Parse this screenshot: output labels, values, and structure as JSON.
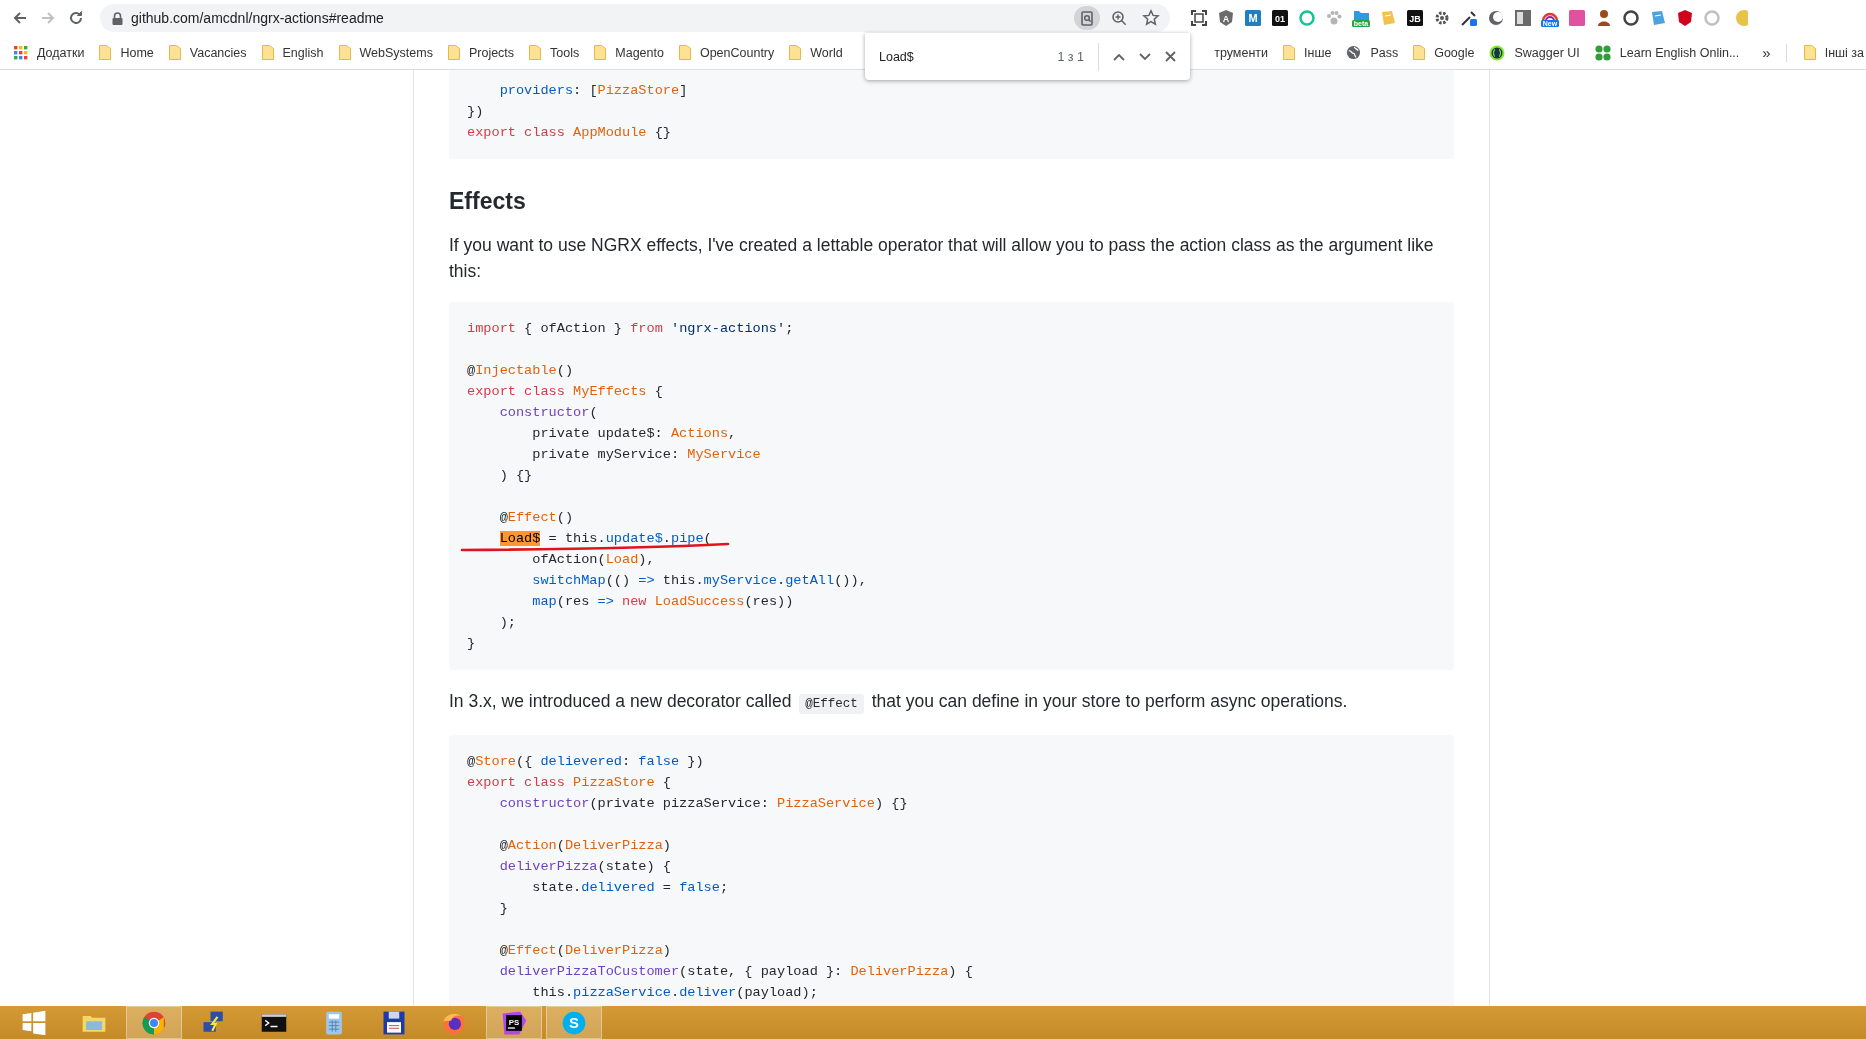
{
  "toolbar": {
    "nav": [
      {
        "kind": "back",
        "disabled": false
      },
      {
        "kind": "forward",
        "disabled": true
      },
      {
        "kind": "reload",
        "disabled": false
      }
    ],
    "url": "github.com/amcdnl/ngrx-actions#readme",
    "url_actions": [
      {
        "kind": "find",
        "active": true
      },
      {
        "kind": "zoom",
        "active": false
      },
      {
        "kind": "star",
        "active": false
      }
    ],
    "extensions": [
      {
        "kind": "crop",
        "color": "#444444"
      },
      {
        "kind": "shield",
        "color": "#6b6b6b",
        "label": "A"
      },
      {
        "kind": "tile",
        "color": "#1f7fc4",
        "label": "M"
      },
      {
        "kind": "tile",
        "color": "#111111",
        "label": "01"
      },
      {
        "kind": "ring",
        "color": "#15c39a"
      },
      {
        "kind": "paw",
        "color": "#b5b5b5"
      },
      {
        "kind": "folder",
        "color": "#2e9ae0",
        "label": "beta"
      },
      {
        "kind": "note",
        "color": "#f2c14e"
      },
      {
        "kind": "tile",
        "color": "#111111",
        "label": "JB"
      },
      {
        "kind": "gear",
        "color": "#555555"
      },
      {
        "kind": "dropper",
        "color": "#1a73e8"
      },
      {
        "kind": "moon",
        "color": "#5f6368"
      },
      {
        "kind": "panel",
        "color": "#6a6a6a"
      },
      {
        "kind": "rainbow",
        "color": "#1a73e8",
        "label": "New"
      },
      {
        "kind": "tile",
        "color": "#e052a0"
      },
      {
        "kind": "blob",
        "color": "#9b4a1c"
      },
      {
        "kind": "ring",
        "color": "#444444"
      },
      {
        "kind": "note",
        "color": "#4aa3df"
      },
      {
        "kind": "shield",
        "color": "#d0021b"
      },
      {
        "kind": "ring",
        "color": "#c0c0c0"
      },
      {
        "kind": "avatar",
        "color": "#e8c34a"
      }
    ]
  },
  "bookmarks": [
    {
      "kind": "apps",
      "label": "Додатки"
    },
    {
      "kind": "folder",
      "label": "Home"
    },
    {
      "kind": "folder",
      "label": "Vacancies"
    },
    {
      "kind": "folder",
      "label": "English"
    },
    {
      "kind": "folder",
      "label": "WebSystems"
    },
    {
      "kind": "folder",
      "label": "Projects"
    },
    {
      "kind": "folder",
      "label": "Tools"
    },
    {
      "kind": "folder",
      "label": "Magento"
    },
    {
      "kind": "folder",
      "label": "OpenCountry"
    },
    {
      "kind": "folder",
      "label": "World"
    }
  ],
  "bookmarks_right": [
    {
      "kind": "cut",
      "label": "трументи"
    },
    {
      "kind": "folder",
      "label": "Інше"
    },
    {
      "kind": "globe",
      "label": "Pass"
    },
    {
      "kind": "folder",
      "label": "Google"
    },
    {
      "kind": "swagger",
      "label": "Swagger UI"
    },
    {
      "kind": "clover",
      "label": "Learn English Onlin..."
    }
  ],
  "bookmarks_more": "»",
  "other_bookmarks": "Інші за",
  "find_bar": {
    "query": "Load$",
    "count": "1 з 1"
  },
  "readme": [
    {
      "kind": "code",
      "cut_top": true,
      "lines": [
        {
          "kind": "code",
          "tokens": [
            {
              "text": "    providers",
              "kind": "constant"
            },
            {
              "text": ": ["
            },
            {
              "text": "PizzaStore",
              "kind": "type"
            },
            {
              "text": "]"
            }
          ]
        },
        {
          "kind": "code",
          "tokens": [
            {
              "text": "})"
            }
          ]
        },
        {
          "kind": "code",
          "tokens": [
            {
              "text": "export class",
              "kind": "keyword"
            },
            {
              "text": " AppModule",
              "kind": "type"
            },
            {
              "text": " {}"
            }
          ]
        }
      ]
    },
    {
      "kind": "heading",
      "text": "Effects"
    },
    {
      "kind": "paragraph",
      "text": "If you want to use NGRX effects, I've created a lettable operator that will allow you to pass the action class as the argument like this:"
    },
    {
      "kind": "code",
      "cut_top": false,
      "lines": [
        {
          "kind": "code",
          "tokens": [
            {
              "text": "import",
              "kind": "keyword"
            },
            {
              "text": " { ofAction } "
            },
            {
              "text": "from",
              "kind": "keyword"
            },
            {
              "text": " 'ngrx-actions'",
              "kind": "string"
            },
            {
              "text": ";"
            }
          ]
        },
        {
          "kind": "blank"
        },
        {
          "kind": "code",
          "tokens": [
            {
              "text": "@"
            },
            {
              "text": "Injectable",
              "kind": "type"
            },
            {
              "text": "()"
            }
          ]
        },
        {
          "kind": "code",
          "tokens": [
            {
              "text": "export class",
              "kind": "keyword"
            },
            {
              "text": " MyEffects",
              "kind": "type"
            },
            {
              "text": " {"
            }
          ]
        },
        {
          "kind": "code",
          "tokens": [
            {
              "text": "    constructor",
              "kind": "function"
            },
            {
              "text": "("
            }
          ]
        },
        {
          "kind": "code",
          "tokens": [
            {
              "text": "        private update$: "
            },
            {
              "text": "Actions",
              "kind": "type"
            },
            {
              "text": ","
            }
          ]
        },
        {
          "kind": "code",
          "tokens": [
            {
              "text": "        private myService: "
            },
            {
              "text": "MyService",
              "kind": "type"
            }
          ]
        },
        {
          "kind": "code",
          "tokens": [
            {
              "text": "    ) {}"
            }
          ]
        },
        {
          "kind": "blank"
        },
        {
          "kind": "code",
          "tokens": [
            {
              "text": "    @"
            },
            {
              "text": "Effect",
              "kind": "type"
            },
            {
              "text": "()"
            }
          ]
        },
        {
          "kind": "code",
          "indented": true,
          "tokens": [
            {
              "text": "Load$",
              "kind": "match"
            },
            {
              "text": " = this."
            },
            {
              "text": "update$",
              "kind": "constant"
            },
            {
              "text": "."
            },
            {
              "text": "pipe",
              "kind": "constant"
            },
            {
              "text": "("
            }
          ]
        },
        {
          "kind": "code",
          "tokens": [
            {
              "text": "        ofAction("
            },
            {
              "text": "Load",
              "kind": "type"
            },
            {
              "text": "),"
            }
          ]
        },
        {
          "kind": "code",
          "tokens": [
            {
              "text": "        switchMap",
              "kind": "constant"
            },
            {
              "text": "(() "
            },
            {
              "text": "=>",
              "kind": "constant"
            },
            {
              "text": " this."
            },
            {
              "text": "myService",
              "kind": "constant"
            },
            {
              "text": "."
            },
            {
              "text": "getAll",
              "kind": "constant"
            },
            {
              "text": "()),"
            }
          ]
        },
        {
          "kind": "code",
          "tokens": [
            {
              "text": "        map",
              "kind": "constant"
            },
            {
              "text": "(res "
            },
            {
              "text": "=>",
              "kind": "constant"
            },
            {
              "text": " new",
              "kind": "keyword"
            },
            {
              "text": " LoadSuccess",
              "kind": "type"
            },
            {
              "text": "(res))"
            }
          ]
        },
        {
          "kind": "code",
          "tokens": [
            {
              "text": "    );"
            }
          ]
        },
        {
          "kind": "code",
          "tokens": [
            {
              "text": "}"
            }
          ]
        }
      ]
    },
    {
      "kind": "paragraph_code",
      "before": "In 3.x, we introduced a new decorator called",
      "code": "@Effect",
      "after": "that you can define in your store to perform async operations."
    },
    {
      "kind": "code",
      "cut_top": false,
      "lines": [
        {
          "kind": "code",
          "tokens": [
            {
              "text": "@"
            },
            {
              "text": "Store",
              "kind": "type"
            },
            {
              "text": "({ "
            },
            {
              "text": "delievered",
              "kind": "constant"
            },
            {
              "text": ": "
            },
            {
              "text": "false",
              "kind": "constant"
            },
            {
              "text": " })"
            }
          ]
        },
        {
          "kind": "code",
          "tokens": [
            {
              "text": "export class",
              "kind": "keyword"
            },
            {
              "text": " PizzaStore",
              "kind": "type"
            },
            {
              "text": " {"
            }
          ]
        },
        {
          "kind": "code",
          "tokens": [
            {
              "text": "    constructor",
              "kind": "function"
            },
            {
              "text": "(private pizzaService: "
            },
            {
              "text": "PizzaService",
              "kind": "type"
            },
            {
              "text": ") {}"
            }
          ]
        },
        {
          "kind": "blank"
        },
        {
          "kind": "code",
          "tokens": [
            {
              "text": "    @"
            },
            {
              "text": "Action",
              "kind": "type"
            },
            {
              "text": "("
            },
            {
              "text": "DeliverPizza",
              "kind": "type"
            },
            {
              "text": ")"
            }
          ]
        },
        {
          "kind": "code",
          "tokens": [
            {
              "text": "    deliverPizza",
              "kind": "function"
            },
            {
              "text": "(state) {"
            }
          ]
        },
        {
          "kind": "code",
          "tokens": [
            {
              "text": "        state."
            },
            {
              "text": "delivered",
              "kind": "constant"
            },
            {
              "text": " = "
            },
            {
              "text": "false",
              "kind": "constant"
            },
            {
              "text": ";"
            }
          ]
        },
        {
          "kind": "code",
          "tokens": [
            {
              "text": "    }"
            }
          ]
        },
        {
          "kind": "blank"
        },
        {
          "kind": "code",
          "tokens": [
            {
              "text": "    @"
            },
            {
              "text": "Effect",
              "kind": "type"
            },
            {
              "text": "("
            },
            {
              "text": "DeliverPizza",
              "kind": "type"
            },
            {
              "text": ")"
            }
          ]
        },
        {
          "kind": "code",
          "tokens": [
            {
              "text": "    deliverPizzaToCustomer",
              "kind": "function"
            },
            {
              "text": "(state, { payload }: "
            },
            {
              "text": "DeliverPizza",
              "kind": "type"
            },
            {
              "text": ") {"
            }
          ]
        },
        {
          "kind": "code",
          "tokens": [
            {
              "text": "        this."
            },
            {
              "text": "pizzaService",
              "kind": "constant"
            },
            {
              "text": "."
            },
            {
              "text": "deliver",
              "kind": "constant"
            },
            {
              "text": "(payload);"
            }
          ]
        }
      ]
    }
  ],
  "taskbar": [
    {
      "kind": "start",
      "running": false
    },
    {
      "kind": "explorer",
      "running": false
    },
    {
      "kind": "chrome",
      "running": true
    },
    {
      "kind": "putty",
      "running": false
    },
    {
      "kind": "terminal",
      "running": false
    },
    {
      "kind": "calculator",
      "running": false
    },
    {
      "kind": "floppy",
      "running": false
    },
    {
      "kind": "firefox",
      "running": false
    },
    {
      "kind": "phpstorm",
      "running": true,
      "label": "PS"
    },
    {
      "kind": "skype",
      "running": true,
      "label": "S"
    }
  ]
}
